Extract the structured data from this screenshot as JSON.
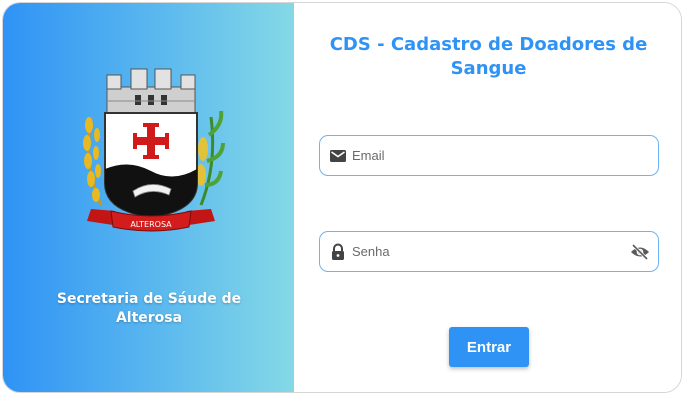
{
  "brand": {
    "organization": "Secretaria de Sáude de Alterosa",
    "crest_banner": "ALTEROSA",
    "crest_icon": "municipal-coat-of-arms"
  },
  "login": {
    "title": "CDS - Cadastro de Doadores de Sangue",
    "email": {
      "placeholder": "Email",
      "value": "",
      "icon": "mail-icon"
    },
    "password": {
      "placeholder": "Senha",
      "value": "",
      "icon": "lock-icon",
      "toggle_icon": "eye-off-icon"
    },
    "submit_label": "Entrar"
  },
  "colors": {
    "accent": "#2f93f5",
    "gradient_start": "#2f93f5",
    "gradient_end": "#84d9e6",
    "field_border": "#6fb3f2",
    "icon": "#444444"
  }
}
